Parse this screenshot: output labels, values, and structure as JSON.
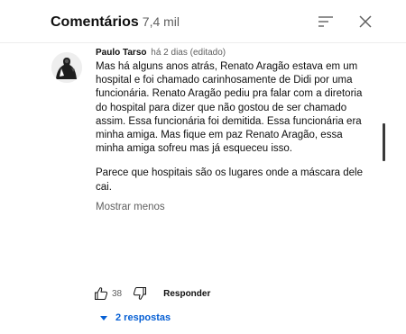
{
  "header": {
    "title": "Comentários",
    "count": "7,4 mil"
  },
  "comment": {
    "author": "Paulo Tarso",
    "time": "há 2 dias (editado)",
    "paragraphs": [
      "Mas há alguns anos atrás,  Renato Aragão estava em um hospital e foi chamado carinhosamente de Didi por uma funcionária. Renato Aragão pediu pra falar com a diretoria do hospital para dizer que não gostou de ser chamado assim. Essa funcionária foi demitida. Essa funcionária era minha amiga. Mas fique em paz Renato Aragão,  essa minha amiga sofreu mas já esqueceu isso.",
      "Parece que hospitais são os lugares onde a máscara dele cai."
    ],
    "show_less": "Mostrar menos",
    "likes": "38",
    "reply_label": "Responder",
    "replies_label": "2 respostas"
  },
  "icons": {
    "sort": "sort-icon",
    "close": "close-icon",
    "like": "thumbs-up-icon",
    "dislike": "thumbs-down-icon",
    "expand": "caret-down-icon"
  },
  "colors": {
    "link": "#065fd4",
    "secondary_text": "#606060"
  }
}
